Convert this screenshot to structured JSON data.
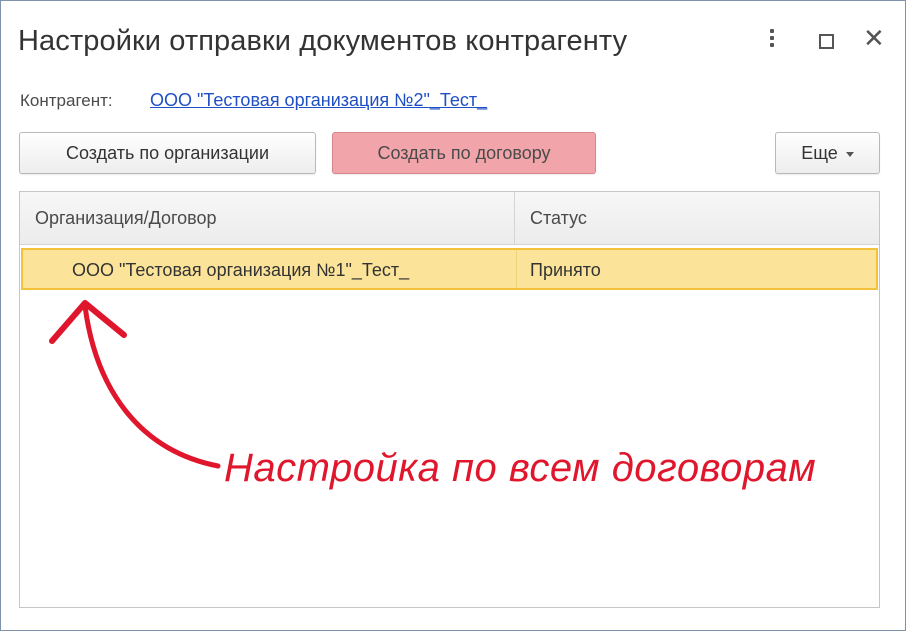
{
  "window": {
    "title": "Настройки отправки документов контрагенту"
  },
  "counterparty": {
    "label": "Контрагент:",
    "value": "ООО \"Тестовая организация №2\"_Тест_"
  },
  "toolbar": {
    "create_by_org": "Создать по организации",
    "create_by_contract": "Создать по договору",
    "more": "Еще"
  },
  "table": {
    "columns": [
      "Организация/Договор",
      "Статус"
    ],
    "rows": [
      {
        "org": "ООО \"Тестовая организация №1\"_Тест_",
        "status": "Принято"
      }
    ]
  },
  "annotation": {
    "text": "Настройка по всем договорам",
    "color": "#e0162d"
  },
  "colors": {
    "highlight_row": "#fbe49a",
    "highlight_border": "#f3c13a",
    "contract_button": "#f1a5aa",
    "link": "#1f4fc4"
  }
}
